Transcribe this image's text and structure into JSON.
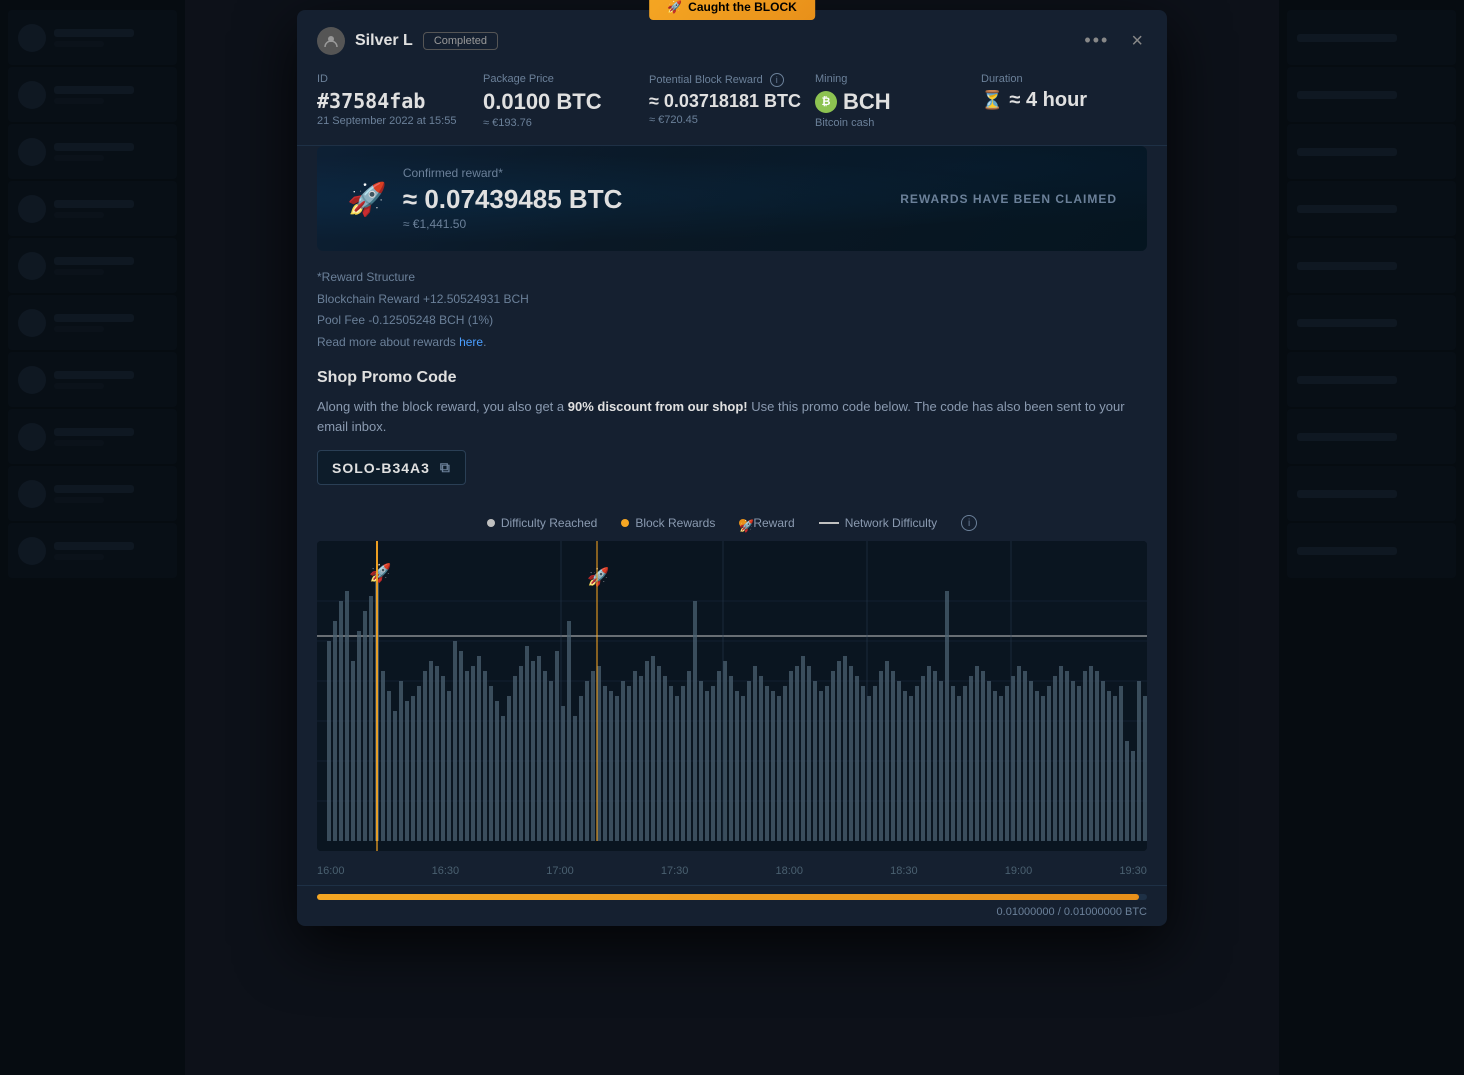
{
  "background": {
    "sidebar_items": 10,
    "right_items": 10
  },
  "modal": {
    "caught_badge": "Caught the BLOCK",
    "user_name": "Silver L",
    "status": "Completed",
    "actions": {
      "dots": "•••",
      "close": "×"
    },
    "id_label": "ID",
    "id_value": "#37584fab",
    "id_date": "21 September 2022 at 15:55",
    "package_price_label": "Package Price",
    "package_price_btc": "0.0100 BTC",
    "package_price_eur": "≈ €193.76",
    "potential_reward_label": "Potential Block Reward",
    "potential_reward_btc": "≈ 0.03718181 BTC",
    "potential_reward_eur": "≈ €720.45",
    "mining_label": "Mining",
    "mining_coin": "BCH",
    "mining_name": "Bitcoin cash",
    "duration_label": "Duration",
    "duration_value": "≈ 4 hour",
    "confirmed_label": "Confirmed reward*",
    "confirmed_amount": "≈ 0.07439485 BTC",
    "confirmed_eur": "≈ €1,441.50",
    "reward_claimed": "REWARDS HAVE BEEN CLAIMED",
    "reward_structure_title": "*Reward Structure",
    "blockchain_reward": "Blockchain Reward +12.50524931 BCH",
    "pool_fee": "Pool Fee -0.12505248 BCH (1%)",
    "read_more_prefix": "Read more about rewards ",
    "read_more_link": "here",
    "shop_promo_title": "Shop Promo Code",
    "shop_promo_desc_pre": "Along with the block reward, you also get a ",
    "shop_promo_discount": "90% discount from our shop!",
    "shop_promo_desc_post": " Use this promo code below. The code has also been sent to your email inbox.",
    "promo_code": "SOLO-B34A3",
    "legend": {
      "difficulty_reached": "Difficulty Reached",
      "block_rewards": "Block Rewards",
      "reward": "Reward",
      "network_difficulty": "Network Difficulty"
    },
    "chart": {
      "time_labels": [
        "16:00",
        "16:30",
        "17:00",
        "17:30",
        "18:00",
        "18:30",
        "19:00",
        "19:30"
      ]
    },
    "progress_value": "0.01000000 / 0.01000000 BTC"
  }
}
